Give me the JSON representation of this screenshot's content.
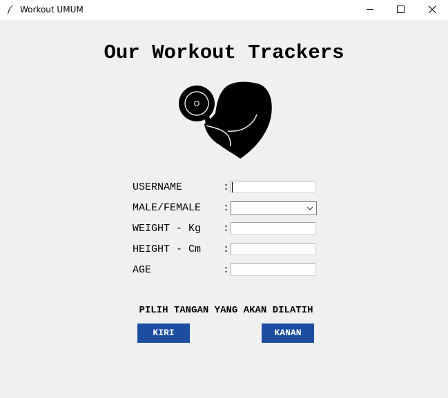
{
  "window": {
    "title": "Workout UMUM",
    "icon": "feather-icon",
    "controls": [
      "minimize-icon",
      "maximize-icon",
      "close-icon"
    ]
  },
  "heading": "Our Workout Trackers",
  "logo_icon": "flexed-bicep-dumbbell-icon",
  "form": {
    "separator": ":",
    "username": {
      "label": "USERNAME",
      "value": ""
    },
    "gender": {
      "label": "MALE/FEMALE",
      "value": ""
    },
    "weight": {
      "label": "WEIGHT - Kg",
      "value": ""
    },
    "height": {
      "label": "HEIGHT - Cm",
      "value": ""
    },
    "age": {
      "label": "AGE",
      "value": ""
    }
  },
  "arm_prompt": "PILIH TANGAN YANG AKAN DILATIH",
  "buttons": {
    "left": "KIRI",
    "right": "KANAN"
  },
  "colors": {
    "background": "#f0f0f0",
    "button": "#1c4da1",
    "button_text": "#ffffff"
  }
}
